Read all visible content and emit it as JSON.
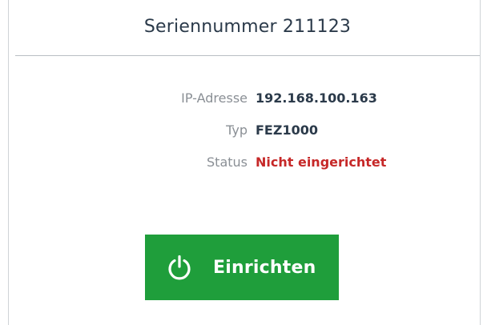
{
  "header": {
    "title": "Seriennummer 211123"
  },
  "details": {
    "rows": [
      {
        "label": "IP-Adresse",
        "value": "192.168.100.163"
      },
      {
        "label": "Typ",
        "value": "FEZ1000"
      },
      {
        "label": "Status",
        "value": "Nicht eingerichtet"
      }
    ]
  },
  "action": {
    "label": "Einrichten",
    "icon": "power-icon",
    "color": "#1f9e3b"
  },
  "colors": {
    "status_error": "#c62828",
    "title_text": "#2b3a4a"
  }
}
